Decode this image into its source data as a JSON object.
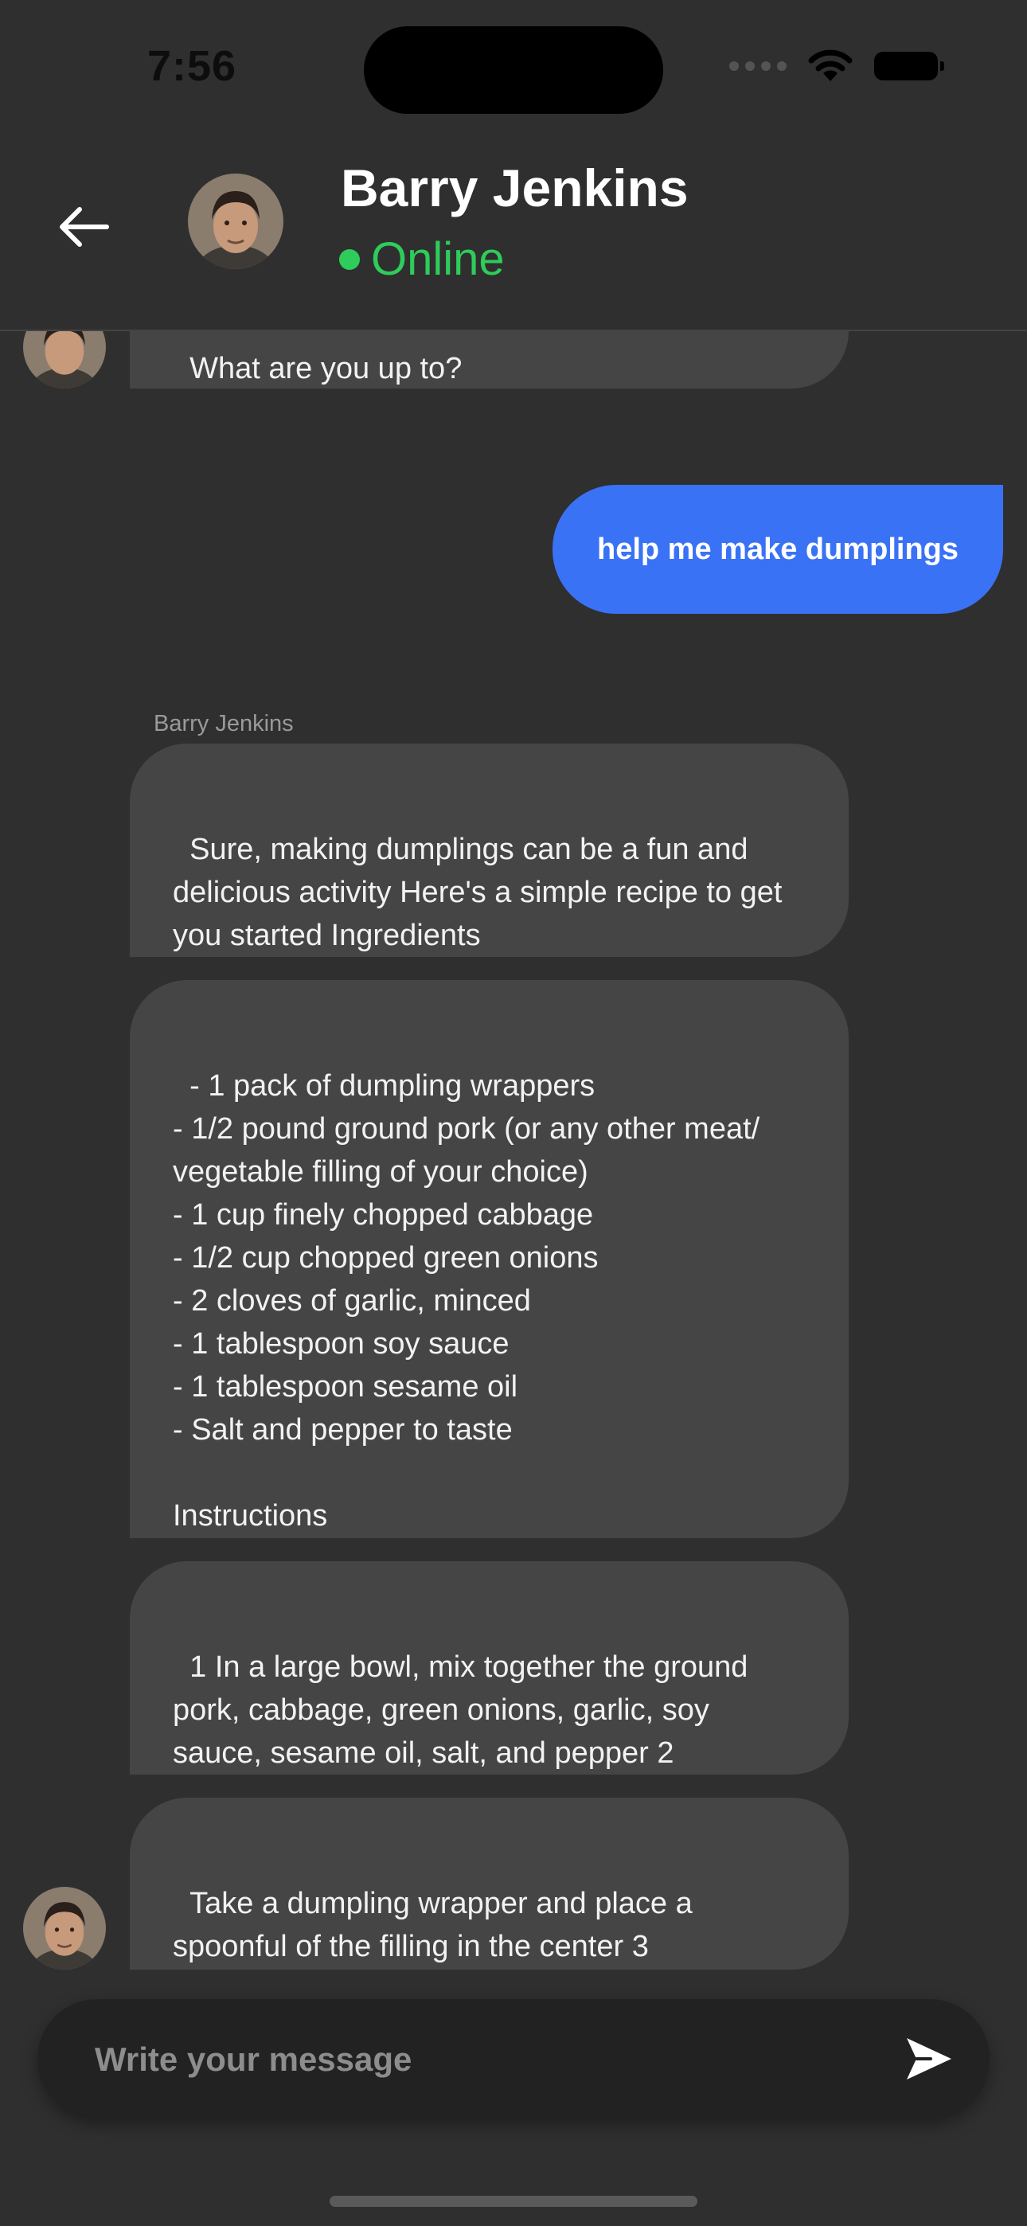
{
  "status": {
    "time": "7:56"
  },
  "header": {
    "name": "Barry Jenkins",
    "status": "Online"
  },
  "messages": {
    "partial_top": "What are you up to?",
    "outgoing": "help me make dumplings",
    "sender_label": "Barry Jenkins",
    "incoming": [
      "Sure, making dumplings can be a fun and delicious activity Here's a simple recipe to get you started Ingredients",
      "- 1 pack of dumpling wrappers\n- 1/2 pound ground pork (or any other meat/\nvegetable filling of your choice)\n- 1 cup finely chopped cabbage\n- 1/2 cup chopped green onions\n- 2 cloves of garlic, minced\n- 1 tablespoon soy sauce\n- 1 tablespoon sesame oil\n- Salt and pepper to taste\n\nInstructions",
      "1 In a large bowl, mix together the ground pork, cabbage, green onions, garlic, soy sauce, sesame oil, salt, and pepper 2",
      "Take a dumpling wrapper and place a spoonful of the filling in the center 3"
    ]
  },
  "composer": {
    "placeholder": "Write your message"
  },
  "icons": {
    "back": "arrow-left-icon",
    "send": "send-icon",
    "signal": "signal-dots-icon",
    "wifi": "wifi-icon",
    "battery": "battery-icon"
  },
  "colors": {
    "background": "#2f2f2f",
    "bubble_in": "#454545",
    "bubble_out": "#3a72f5",
    "online": "#2ecc5a"
  }
}
